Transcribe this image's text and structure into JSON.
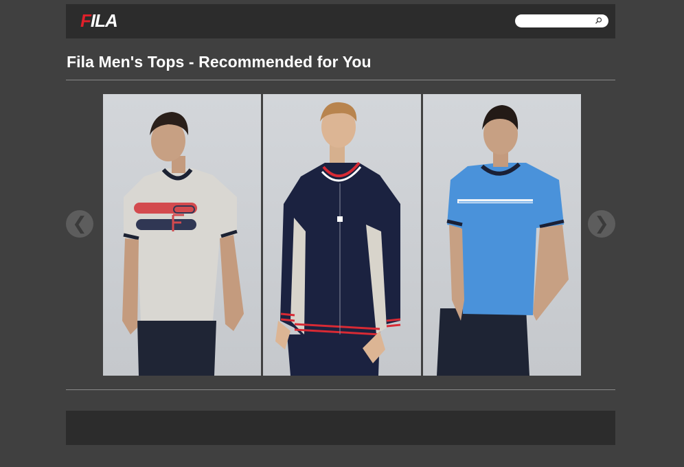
{
  "header": {
    "logo": {
      "text": "FILA",
      "red_part": "F",
      "white_part": "ILA"
    },
    "search": {
      "placeholder": "",
      "value": "",
      "button_icon": "search-icon"
    }
  },
  "page": {
    "title": "Fila Men's Tops - Recommended for You"
  },
  "carousel": {
    "prev_label": "❮",
    "next_label": "❯",
    "items": [
      {
        "description_icon": "gray-tshirt-product",
        "shirt_color": "#d9d7d2",
        "accent": "#222a3e"
      },
      {
        "description_icon": "navy-track-jacket-product",
        "shirt_color": "#1b2240",
        "accent": "#d82a34"
      },
      {
        "description_icon": "blue-tshirt-product",
        "shirt_color": "#4a92da",
        "accent": "#1a2036"
      }
    ]
  },
  "colors": {
    "page_bg": "#404040",
    "header_bg": "#2c2c2c",
    "brand_red": "#e0202a",
    "text": "#ffffff"
  }
}
